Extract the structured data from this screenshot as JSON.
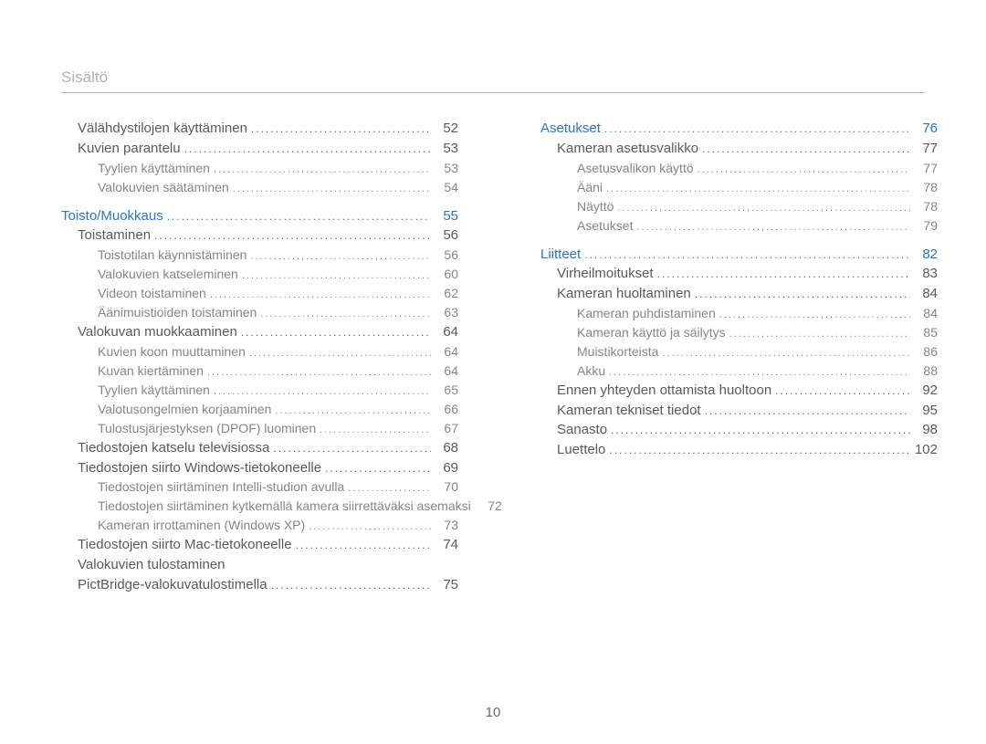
{
  "header": {
    "title": "Sisältö"
  },
  "footer": {
    "page": "10"
  },
  "dots": "...........................................................................................................................",
  "left": [
    {
      "label": "Välähdystilojen käyttäminen",
      "page": "52",
      "indent": 1,
      "cls": ""
    },
    {
      "label": "Kuvien parantelu",
      "page": "53",
      "indent": 1,
      "cls": ""
    },
    {
      "label": "Tyylien käyttäminen",
      "page": "53",
      "indent": 2,
      "cls": "small"
    },
    {
      "label": "Valokuvien säätäminen",
      "page": "54",
      "indent": 2,
      "cls": "small"
    },
    {
      "spacer": true
    },
    {
      "label": "Toisto/Muokkaus",
      "page": "55",
      "indent": 0,
      "cls": "head"
    },
    {
      "label": "Toistaminen",
      "page": "56",
      "indent": 1,
      "cls": ""
    },
    {
      "label": "Toistotilan käynnistäminen",
      "page": "56",
      "indent": 2,
      "cls": "small"
    },
    {
      "label": "Valokuvien katseleminen",
      "page": "60",
      "indent": 2,
      "cls": "small"
    },
    {
      "label": "Videon toistaminen",
      "page": "62",
      "indent": 2,
      "cls": "small"
    },
    {
      "label": "Äänimuistioiden toistaminen",
      "page": "63",
      "indent": 2,
      "cls": "small"
    },
    {
      "label": "Valokuvan muokkaaminen",
      "page": "64",
      "indent": 1,
      "cls": ""
    },
    {
      "label": "Kuvien koon muuttaminen",
      "page": "64",
      "indent": 2,
      "cls": "small"
    },
    {
      "label": "Kuvan kiertäminen",
      "page": "64",
      "indent": 2,
      "cls": "small"
    },
    {
      "label": "Tyylien käyttäminen",
      "page": "65",
      "indent": 2,
      "cls": "small"
    },
    {
      "label": "Valotusongelmien korjaaminen",
      "page": "66",
      "indent": 2,
      "cls": "small"
    },
    {
      "label": "Tulostusjärjestyksen (DPOF) luominen",
      "page": "67",
      "indent": 2,
      "cls": "small"
    },
    {
      "label": "Tiedostojen katselu televisiossa",
      "page": "68",
      "indent": 1,
      "cls": ""
    },
    {
      "label": "Tiedostojen siirto Windows-tietokoneelle",
      "page": "69",
      "indent": 1,
      "cls": ""
    },
    {
      "label": "Tiedostojen siirtäminen Intelli-studion avulla",
      "page": "70",
      "indent": 2,
      "cls": "small"
    },
    {
      "label": "Tiedostojen siirtäminen kytkemällä kamera siirrettäväksi asemaksi",
      "page": "72",
      "indent": 2,
      "cls": "small",
      "multi": true
    },
    {
      "label": "Kameran irrottaminen (Windows XP)",
      "page": "73",
      "indent": 2,
      "cls": "small"
    },
    {
      "label": "Tiedostojen siirto Mac-tietokoneelle",
      "page": "74",
      "indent": 1,
      "cls": ""
    },
    {
      "label": "Valokuvien tulostaminen",
      "page": "",
      "indent": 1,
      "cls": "",
      "nodots": true
    },
    {
      "label": "PictBridge-valokuvatulostimella",
      "page": "75",
      "indent": 1,
      "cls": ""
    }
  ],
  "right": [
    {
      "label": "Asetukset",
      "page": "76",
      "indent": 0,
      "cls": "head"
    },
    {
      "label": "Kameran asetusvalikko",
      "page": "77",
      "indent": 1,
      "cls": ""
    },
    {
      "label": "Asetusvalikon käyttö",
      "page": "77",
      "indent": 2,
      "cls": "small"
    },
    {
      "label": "Ääni",
      "page": "78",
      "indent": 2,
      "cls": "small"
    },
    {
      "label": "Näyttö",
      "page": "78",
      "indent": 2,
      "cls": "small"
    },
    {
      "label": "Asetukset",
      "page": "79",
      "indent": 2,
      "cls": "small"
    },
    {
      "spacer": true
    },
    {
      "label": "Liitteet",
      "page": "82",
      "indent": 0,
      "cls": "head"
    },
    {
      "label": "Virheilmoitukset",
      "page": "83",
      "indent": 1,
      "cls": ""
    },
    {
      "label": "Kameran huoltaminen",
      "page": "84",
      "indent": 1,
      "cls": ""
    },
    {
      "label": "Kameran puhdistaminen",
      "page": "84",
      "indent": 2,
      "cls": "small"
    },
    {
      "label": "Kameran käyttö ja säilytys",
      "page": "85",
      "indent": 2,
      "cls": "small"
    },
    {
      "label": "Muistikorteista",
      "page": "86",
      "indent": 2,
      "cls": "small"
    },
    {
      "label": "Akku",
      "page": "88",
      "indent": 2,
      "cls": "small"
    },
    {
      "label": "Ennen yhteyden ottamista huoltoon",
      "page": "92",
      "indent": 1,
      "cls": ""
    },
    {
      "label": "Kameran tekniset tiedot",
      "page": "95",
      "indent": 1,
      "cls": ""
    },
    {
      "label": "Sanasto",
      "page": "98",
      "indent": 1,
      "cls": ""
    },
    {
      "label": "Luettelo",
      "page": "102",
      "indent": 1,
      "cls": ""
    }
  ]
}
